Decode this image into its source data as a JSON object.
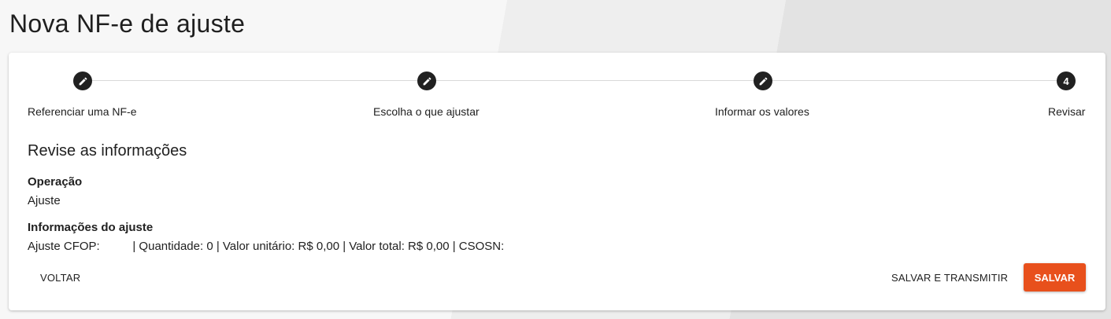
{
  "page": {
    "title": "Nova NF-e de ajuste"
  },
  "stepper": {
    "steps": [
      {
        "label": "Referenciar uma NF-e",
        "icon": "pencil-icon",
        "state": "completed"
      },
      {
        "label": "Escolha o que ajustar",
        "icon": "pencil-icon",
        "state": "completed"
      },
      {
        "label": "Informar os valores",
        "icon": "pencil-icon",
        "state": "completed"
      },
      {
        "label": "Revisar",
        "number": "4",
        "state": "active"
      }
    ]
  },
  "review": {
    "title": "Revise as informações",
    "operacao": {
      "label": "Operação",
      "value": "Ajuste"
    },
    "informacoes": {
      "label": "Informações do ajuste",
      "value": "Ajuste CFOP:          | Quantidade: 0 | Valor unitário: R$ 0,00 | Valor total: R$ 0,00 | CSOSN:"
    }
  },
  "actions": {
    "back_label": "VOLTAR",
    "save_transmit_label": "SALVAR E TRANSMITIR",
    "save_label": "SALVAR"
  },
  "colors": {
    "primary_button": "#e8501c",
    "step_circle": "#212121",
    "step_line": "#d9d9d9"
  }
}
